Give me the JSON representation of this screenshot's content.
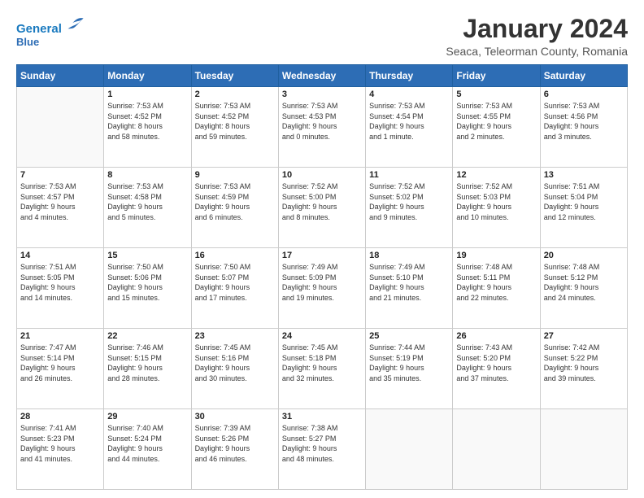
{
  "header": {
    "logo_line1": "General",
    "logo_line2": "Blue",
    "month_year": "January 2024",
    "location": "Seaca, Teleorman County, Romania"
  },
  "weekdays": [
    "Sunday",
    "Monday",
    "Tuesday",
    "Wednesday",
    "Thursday",
    "Friday",
    "Saturday"
  ],
  "weeks": [
    [
      {
        "day": "",
        "info": ""
      },
      {
        "day": "1",
        "info": "Sunrise: 7:53 AM\nSunset: 4:52 PM\nDaylight: 8 hours\nand 58 minutes."
      },
      {
        "day": "2",
        "info": "Sunrise: 7:53 AM\nSunset: 4:52 PM\nDaylight: 8 hours\nand 59 minutes."
      },
      {
        "day": "3",
        "info": "Sunrise: 7:53 AM\nSunset: 4:53 PM\nDaylight: 9 hours\nand 0 minutes."
      },
      {
        "day": "4",
        "info": "Sunrise: 7:53 AM\nSunset: 4:54 PM\nDaylight: 9 hours\nand 1 minute."
      },
      {
        "day": "5",
        "info": "Sunrise: 7:53 AM\nSunset: 4:55 PM\nDaylight: 9 hours\nand 2 minutes."
      },
      {
        "day": "6",
        "info": "Sunrise: 7:53 AM\nSunset: 4:56 PM\nDaylight: 9 hours\nand 3 minutes."
      }
    ],
    [
      {
        "day": "7",
        "info": "Sunrise: 7:53 AM\nSunset: 4:57 PM\nDaylight: 9 hours\nand 4 minutes."
      },
      {
        "day": "8",
        "info": "Sunrise: 7:53 AM\nSunset: 4:58 PM\nDaylight: 9 hours\nand 5 minutes."
      },
      {
        "day": "9",
        "info": "Sunrise: 7:53 AM\nSunset: 4:59 PM\nDaylight: 9 hours\nand 6 minutes."
      },
      {
        "day": "10",
        "info": "Sunrise: 7:52 AM\nSunset: 5:00 PM\nDaylight: 9 hours\nand 8 minutes."
      },
      {
        "day": "11",
        "info": "Sunrise: 7:52 AM\nSunset: 5:02 PM\nDaylight: 9 hours\nand 9 minutes."
      },
      {
        "day": "12",
        "info": "Sunrise: 7:52 AM\nSunset: 5:03 PM\nDaylight: 9 hours\nand 10 minutes."
      },
      {
        "day": "13",
        "info": "Sunrise: 7:51 AM\nSunset: 5:04 PM\nDaylight: 9 hours\nand 12 minutes."
      }
    ],
    [
      {
        "day": "14",
        "info": "Sunrise: 7:51 AM\nSunset: 5:05 PM\nDaylight: 9 hours\nand 14 minutes."
      },
      {
        "day": "15",
        "info": "Sunrise: 7:50 AM\nSunset: 5:06 PM\nDaylight: 9 hours\nand 15 minutes."
      },
      {
        "day": "16",
        "info": "Sunrise: 7:50 AM\nSunset: 5:07 PM\nDaylight: 9 hours\nand 17 minutes."
      },
      {
        "day": "17",
        "info": "Sunrise: 7:49 AM\nSunset: 5:09 PM\nDaylight: 9 hours\nand 19 minutes."
      },
      {
        "day": "18",
        "info": "Sunrise: 7:49 AM\nSunset: 5:10 PM\nDaylight: 9 hours\nand 21 minutes."
      },
      {
        "day": "19",
        "info": "Sunrise: 7:48 AM\nSunset: 5:11 PM\nDaylight: 9 hours\nand 22 minutes."
      },
      {
        "day": "20",
        "info": "Sunrise: 7:48 AM\nSunset: 5:12 PM\nDaylight: 9 hours\nand 24 minutes."
      }
    ],
    [
      {
        "day": "21",
        "info": "Sunrise: 7:47 AM\nSunset: 5:14 PM\nDaylight: 9 hours\nand 26 minutes."
      },
      {
        "day": "22",
        "info": "Sunrise: 7:46 AM\nSunset: 5:15 PM\nDaylight: 9 hours\nand 28 minutes."
      },
      {
        "day": "23",
        "info": "Sunrise: 7:45 AM\nSunset: 5:16 PM\nDaylight: 9 hours\nand 30 minutes."
      },
      {
        "day": "24",
        "info": "Sunrise: 7:45 AM\nSunset: 5:18 PM\nDaylight: 9 hours\nand 32 minutes."
      },
      {
        "day": "25",
        "info": "Sunrise: 7:44 AM\nSunset: 5:19 PM\nDaylight: 9 hours\nand 35 minutes."
      },
      {
        "day": "26",
        "info": "Sunrise: 7:43 AM\nSunset: 5:20 PM\nDaylight: 9 hours\nand 37 minutes."
      },
      {
        "day": "27",
        "info": "Sunrise: 7:42 AM\nSunset: 5:22 PM\nDaylight: 9 hours\nand 39 minutes."
      }
    ],
    [
      {
        "day": "28",
        "info": "Sunrise: 7:41 AM\nSunset: 5:23 PM\nDaylight: 9 hours\nand 41 minutes."
      },
      {
        "day": "29",
        "info": "Sunrise: 7:40 AM\nSunset: 5:24 PM\nDaylight: 9 hours\nand 44 minutes."
      },
      {
        "day": "30",
        "info": "Sunrise: 7:39 AM\nSunset: 5:26 PM\nDaylight: 9 hours\nand 46 minutes."
      },
      {
        "day": "31",
        "info": "Sunrise: 7:38 AM\nSunset: 5:27 PM\nDaylight: 9 hours\nand 48 minutes."
      },
      {
        "day": "",
        "info": ""
      },
      {
        "day": "",
        "info": ""
      },
      {
        "day": "",
        "info": ""
      }
    ]
  ]
}
